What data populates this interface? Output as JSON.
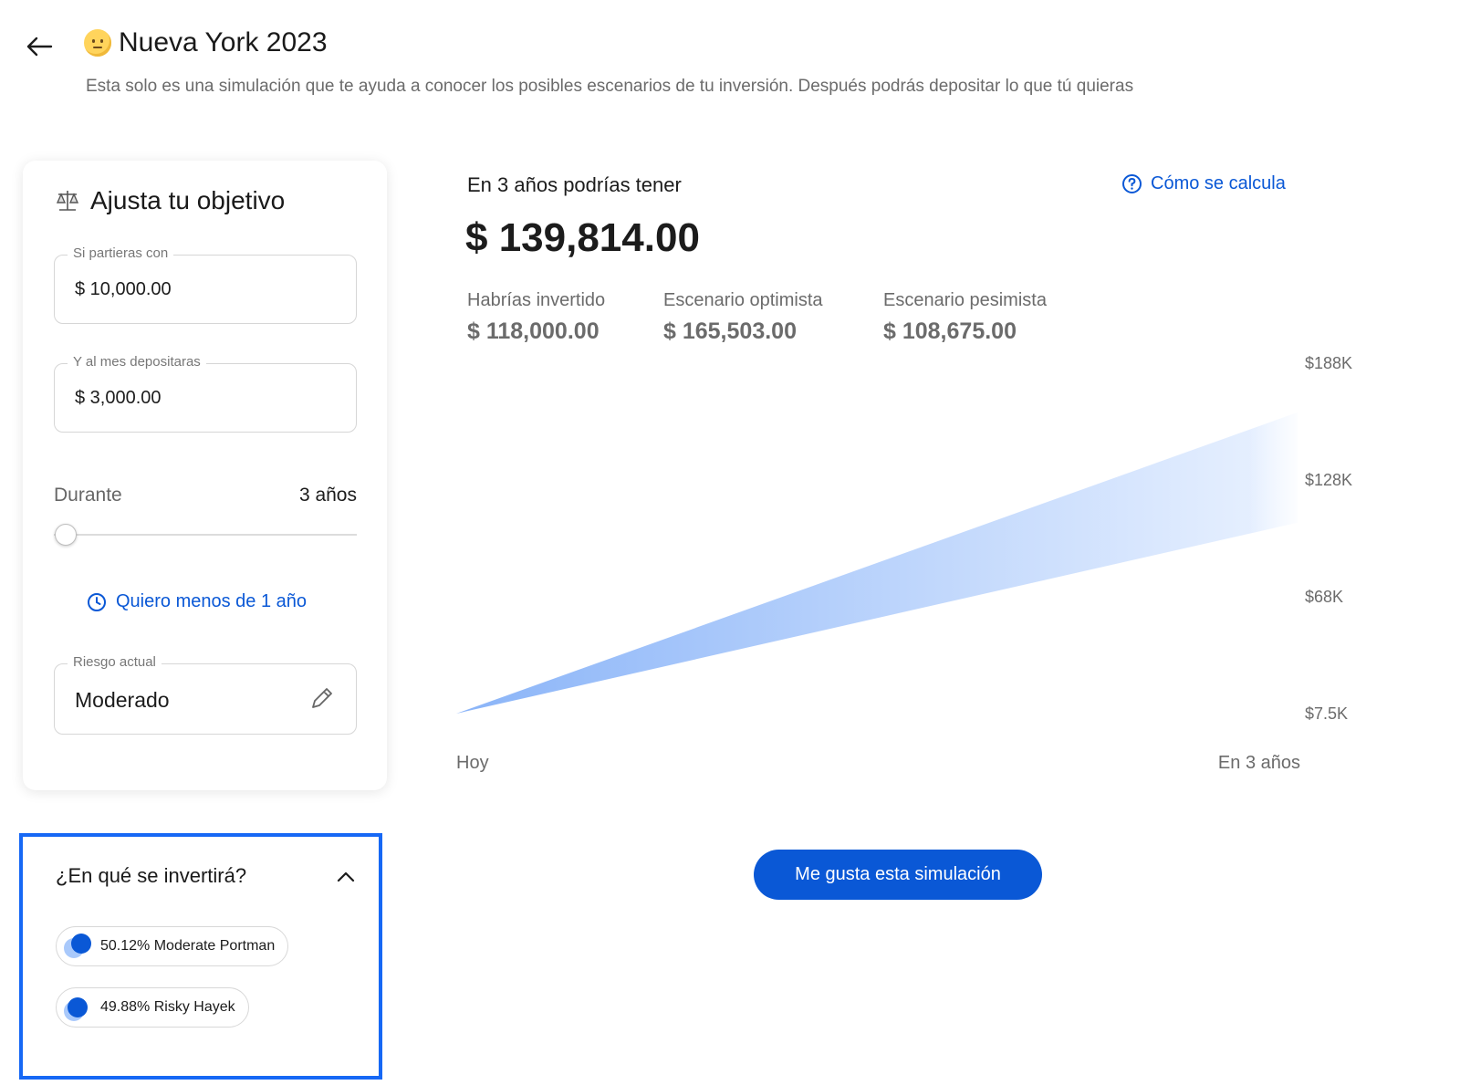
{
  "header": {
    "title": "Nueva York 2023",
    "subtitle": "Esta solo es una simulación que te ayuda a conocer los posibles escenarios de tu inversión. Después podrás depositar lo que tú quieras"
  },
  "form": {
    "title": "Ajusta tu objetivo",
    "initial": {
      "label": "Si partieras con",
      "value": "$ 10,000.00"
    },
    "monthly": {
      "label": "Y al mes depositaras",
      "value": "$ 3,000.00"
    },
    "duration": {
      "label": "Durante",
      "value": "3 años",
      "level": 0
    },
    "less_than_year_link": "Quiero menos de 1 año",
    "risk": {
      "label": "Riesgo actual",
      "value": "Moderado"
    }
  },
  "investments": {
    "title": "¿En qué se invertirá?",
    "items": [
      {
        "label": "50.12% Moderate Portman"
      },
      {
        "label": "49.88% Risky Hayek"
      }
    ]
  },
  "result": {
    "label": "En 3 años podrías tener",
    "how_link": "Cómo se calcula",
    "amount": "$ 139,814.00",
    "stats": [
      {
        "label": "Habrías invertido",
        "value": "$ 118,000.00"
      },
      {
        "label": "Escenario optimista",
        "value": "$ 165,503.00"
      },
      {
        "label": "Escenario pesimista",
        "value": "$ 108,675.00"
      }
    ]
  },
  "chart_data": {
    "type": "area",
    "x": [
      "Hoy",
      "En 3 años"
    ],
    "y_ticks": [
      "$188K",
      "$128K",
      "$68K",
      "$7.5K"
    ],
    "ylim": [
      7500,
      188000
    ],
    "series": [
      {
        "values": [
          7500,
          165503
        ]
      },
      {
        "values": [
          7500,
          108675
        ]
      }
    ],
    "colors": {
      "start": "#8ab4f8",
      "end": "#eaf2ff"
    }
  },
  "cta": {
    "label": "Me gusta esta simulación"
  },
  "colors": {
    "accent": "#0a58d6",
    "highlight_border": "#1668f5"
  }
}
